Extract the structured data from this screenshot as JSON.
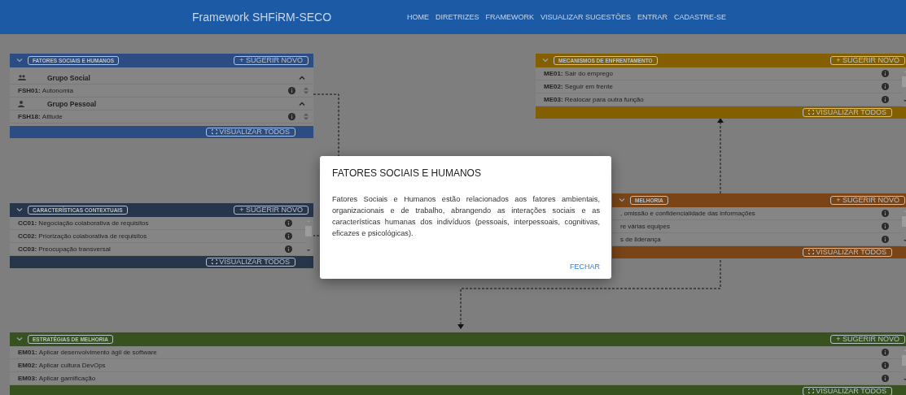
{
  "navbar": {
    "title": "Framework SHFiRM-SECO",
    "links": [
      "HOME",
      "DIRETRIZES",
      "FRAMEWORK",
      "VISUALIZAR SUGESTÕES",
      "ENTRAR",
      "CADASTRE-SE"
    ]
  },
  "panels": [
    {
      "kind": "grouped",
      "title": "FATORES SOCIAIS E HUMANOS",
      "color": "#2c4d83",
      "suggest": "+ SUGERIR NOVO",
      "view_all": "VISUALIZAR TODOS",
      "groups": [
        {
          "name": "Grupo Social",
          "kind": "people",
          "expanded": true,
          "items": [
            {
              "code": "FSH01:",
              "text": "Autonomia"
            }
          ]
        },
        {
          "name": "Grupo Pessoal",
          "kind": "person",
          "expanded": true,
          "items": [
            {
              "code": "FSH18:",
              "text": "Atitude"
            }
          ]
        }
      ]
    },
    {
      "kind": "list",
      "title": "CARACTERÍSTICAS CONTEXTUAIS",
      "color": "#27364a",
      "suggest": "+ SUGERIR NOVO",
      "view_all": "VISUALIZAR TODOS",
      "items": [
        {
          "code": "CC01:",
          "text": "Negociação colaborativa de requisitos"
        },
        {
          "code": "CC02:",
          "text": "Priorização colaborativa de requisitos"
        },
        {
          "code": "CC03:",
          "text": "Preocupação transversal"
        }
      ]
    },
    {
      "kind": "list",
      "title": "MECANISMOS DE ENFRENTAMENTO",
      "color": "#845f00",
      "suggest": "+ SUGERIR NOVO",
      "view_all": "VISUALIZAR TODOS",
      "items": [
        {
          "code": "ME01:",
          "text": "Sair do emprego"
        },
        {
          "code": "ME02:",
          "text": "Seguir em frente"
        },
        {
          "code": "ME03:",
          "text": "Realocar para outra função"
        }
      ]
    },
    {
      "kind": "list",
      "title": "MELHORIA",
      "color": "#7a4416",
      "suggest": "+ SUGERIR NOVO",
      "view_all": "VISUALIZAR TODOS",
      "items": [
        {
          "text": ", omissão e confidencialidade das informações"
        },
        {
          "text": "re várias equipes"
        },
        {
          "text": "s de liderança"
        }
      ]
    },
    {
      "kind": "list",
      "title": "ESTRATÉGIAS DE MELHORIA",
      "color": "#37521f",
      "suggest": "+ SUGERIR NOVO",
      "view_all": "VISUALIZAR TODOS",
      "items": [
        {
          "code": "EM01:",
          "text": "Aplicar desenvolvimento ágil de software"
        },
        {
          "code": "EM02:",
          "text": "Aplicar cultura DevOps"
        },
        {
          "code": "EM03:",
          "text": "Aplicar gamificação"
        }
      ]
    }
  ],
  "modal": {
    "title": "FATORES SOCIAIS E HUMANOS",
    "body": "Fatores Sociais e Humanos estão relacionados aos fatores ambientais, organizacionais e de trabalho, abrangendo as interações sociais e as características humanas dos indivíduos (pessoais, interpessoais, cognitivas, eficazes e psicológicas).",
    "close": "FECHAR"
  }
}
